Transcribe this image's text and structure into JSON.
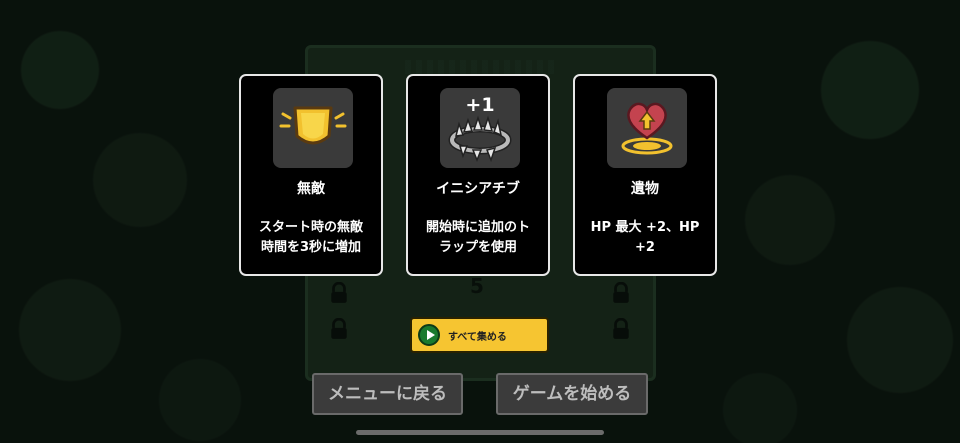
{
  "cards": [
    {
      "id": "invincible",
      "icon": "shield-icon",
      "title": "無敵",
      "description_line1": "スタート時の無敵",
      "description_line2": "時間を3秒に増加"
    },
    {
      "id": "initiative",
      "icon": "bear-trap-icon",
      "badge": "+1",
      "title": "イニシアチブ",
      "description_line1": "開始時に追加のト",
      "description_line2": "ラップを使用"
    },
    {
      "id": "relic",
      "icon": "heart-upgrade-icon",
      "title": "遺物",
      "description_line1": "HP 最大 +2、HP",
      "description_line2": "+2"
    }
  ],
  "collect_all": {
    "icon": "play-icon",
    "label": "すべて集める"
  },
  "buttons": {
    "back_to_menu": "メニューに戻る",
    "start_game": "ゲームを始める"
  },
  "board": {
    "number": "5"
  },
  "colors": {
    "card_bg": "#000000",
    "card_border": "#e8e8e8",
    "collect_button": "#f6c531",
    "menu_button": "#3b3b3b"
  }
}
